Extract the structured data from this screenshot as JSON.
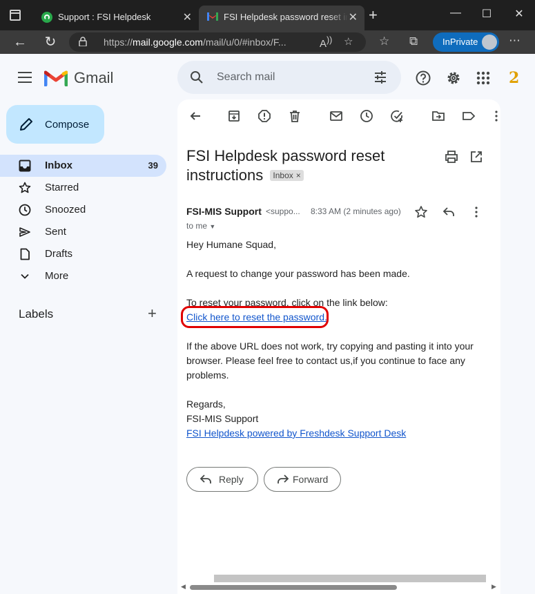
{
  "browser": {
    "tabs": [
      {
        "title": "Support : FSI Helpdesk"
      },
      {
        "title": "FSI Helpdesk password reset inst"
      }
    ],
    "url_prefix": "https://",
    "url_host": "mail.google.com",
    "url_path": "/mail/u/0/#inbox/F...",
    "inprivate_label": "InPrivate"
  },
  "gmail": {
    "logo_text": "Gmail",
    "search_placeholder": "Search mail",
    "compose_label": "Compose",
    "nav": [
      {
        "label": "Inbox",
        "count": "39"
      },
      {
        "label": "Starred"
      },
      {
        "label": "Snoozed"
      },
      {
        "label": "Sent"
      },
      {
        "label": "Drafts"
      },
      {
        "label": "More"
      }
    ],
    "labels_title": "Labels",
    "avatar_text": "2"
  },
  "message": {
    "subject": "FSI Helpdesk password reset instructions",
    "badge": "Inbox",
    "sender_name": "FSI-MIS Support",
    "sender_email": "<suppo...",
    "time": "8:33 AM (2 minutes ago)",
    "to": "to me",
    "greeting": "Hey Humane Squad,",
    "line1": "A request to change your password has been made.",
    "line2": "To reset your password, click on the link below:",
    "reset_link": "Click here to reset the password.",
    "line3": "If the above URL does not work, try copying and pasting it into your browser. Please feel free to contact us,if you continue to face any problems.",
    "regards": "Regards,",
    "signature": "FSI-MIS Support",
    "footer_link": "FSI Helpdesk powered by Freshdesk Support Desk",
    "reply_label": "Reply",
    "forward_label": "Forward"
  },
  "colors": {
    "highlight_ring": "#e00000",
    "link": "#1155cc",
    "compose_bg": "#c2e7ff",
    "inbox_active_bg": "#d3e3fd",
    "inprivate_bg": "#0f6cbd"
  }
}
